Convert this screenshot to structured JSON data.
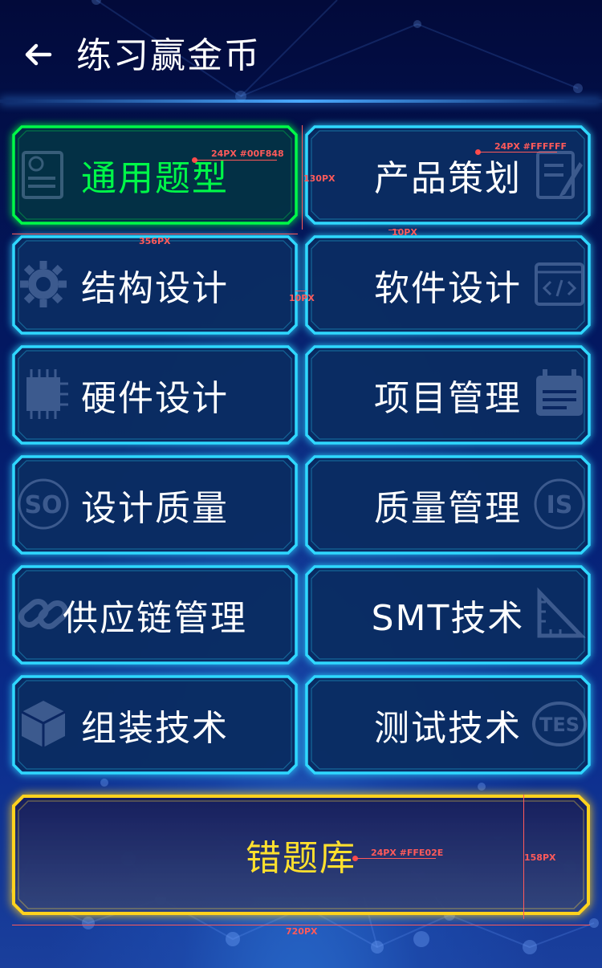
{
  "header": {
    "title": "练习赢金币"
  },
  "categories": [
    {
      "label": "通用题型",
      "active": true
    },
    {
      "label": "产品策划",
      "active": false
    },
    {
      "label": "结构设计",
      "active": false
    },
    {
      "label": "软件设计",
      "active": false
    },
    {
      "label": "硬件设计",
      "active": false
    },
    {
      "label": "项目管理",
      "active": false
    },
    {
      "label": "设计质量",
      "active": false
    },
    {
      "label": "质量管理",
      "active": false
    },
    {
      "label": "供应链管理",
      "active": false
    },
    {
      "label": "SMT技术",
      "active": false
    },
    {
      "label": "组装技术",
      "active": false
    },
    {
      "label": "测试技术",
      "active": false
    }
  ],
  "wrong_bank": {
    "label": "错题库"
  },
  "icons": [
    "back-arrow-icon",
    "exam-paper-icon",
    "document-pen-icon",
    "gear-icon",
    "code-icon",
    "chip-icon",
    "calendar-icon",
    "iso-icon",
    "iso-certificate-icon",
    "chain-link-icon",
    "ruler-icon",
    "cubes-icon",
    "test-badge-icon"
  ],
  "colors": {
    "active_text": "#00F848",
    "default_text": "#FFFFFF",
    "wrong_bank_text": "#FFE02E",
    "card_border": "#2fd8ff",
    "active_border": "#00f848",
    "wrong_border": "#ffd21e"
  },
  "annotations": {
    "active_font": "24PX #00F848",
    "default_font": "24PX #FFFFFF",
    "card_height": "130PX",
    "card_width": "356PX",
    "row_gap": "10PX",
    "col_gap": "10PX",
    "wrong_font": "24PX #FFE02E",
    "wrong_height": "158PX",
    "wrong_width": "720PX"
  }
}
